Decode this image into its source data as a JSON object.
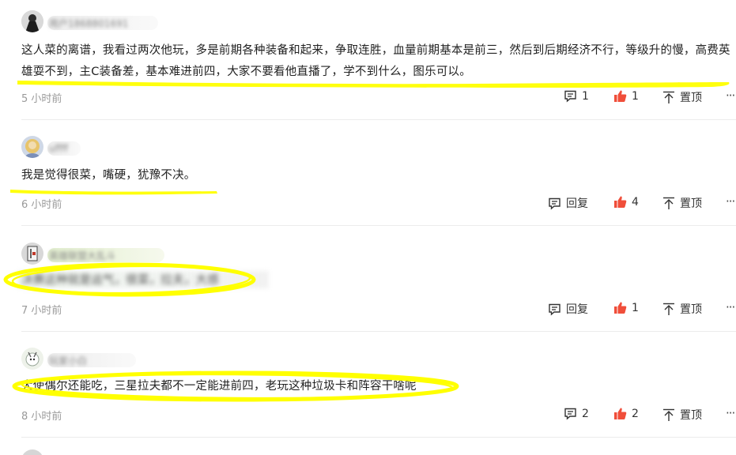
{
  "colors": {
    "highlight": "#ffff00",
    "like": "#f04e3a",
    "muted": "#9a9a9a"
  },
  "icons": {
    "comment": "comment-bubble-icon",
    "reply": "reply-icon",
    "like": "thumbs-up-icon",
    "pin": "pin-top-icon",
    "more": "more-dots-icon"
  },
  "comments": [
    {
      "username": "用户1868801691",
      "text": "这人菜的离谱，我看过两次他玩，多是前期各种装备和起来，争取连胜，血量前期基本是前三，然后到后期经济不行，等级升的慢，高费英雄耍不到，主C装备差，基本难进前四，大家不要看他直播了，学不到什么，图乐可以。",
      "time": "5 小时前",
      "reply_action": "1",
      "likes": "1",
      "pin": "置顶",
      "more": "···"
    },
    {
      "username": "uffff",
      "text": "我是觉得很菜，嘴硬，犹豫不决。",
      "time": "6 小时前",
      "reply_action": "回复",
      "likes": "4",
      "pin": "置顶",
      "more": "···"
    },
    {
      "username": "英雄联盟大乱斗",
      "text": "决赛这种就是运气，很菜，拉夫，大感",
      "time": "7 小时前",
      "reply_action": "回复",
      "likes": "1",
      "pin": "置顶",
      "more": "···"
    },
    {
      "username": "玩家小白",
      "text": "大使偶尔还能吃，三星拉夫都不一定能进前四，老玩这种垃圾卡和阵容干啥呢",
      "time": "8 小时前",
      "reply_action": "2",
      "likes": "2",
      "pin": "置顶",
      "more": "···"
    }
  ]
}
